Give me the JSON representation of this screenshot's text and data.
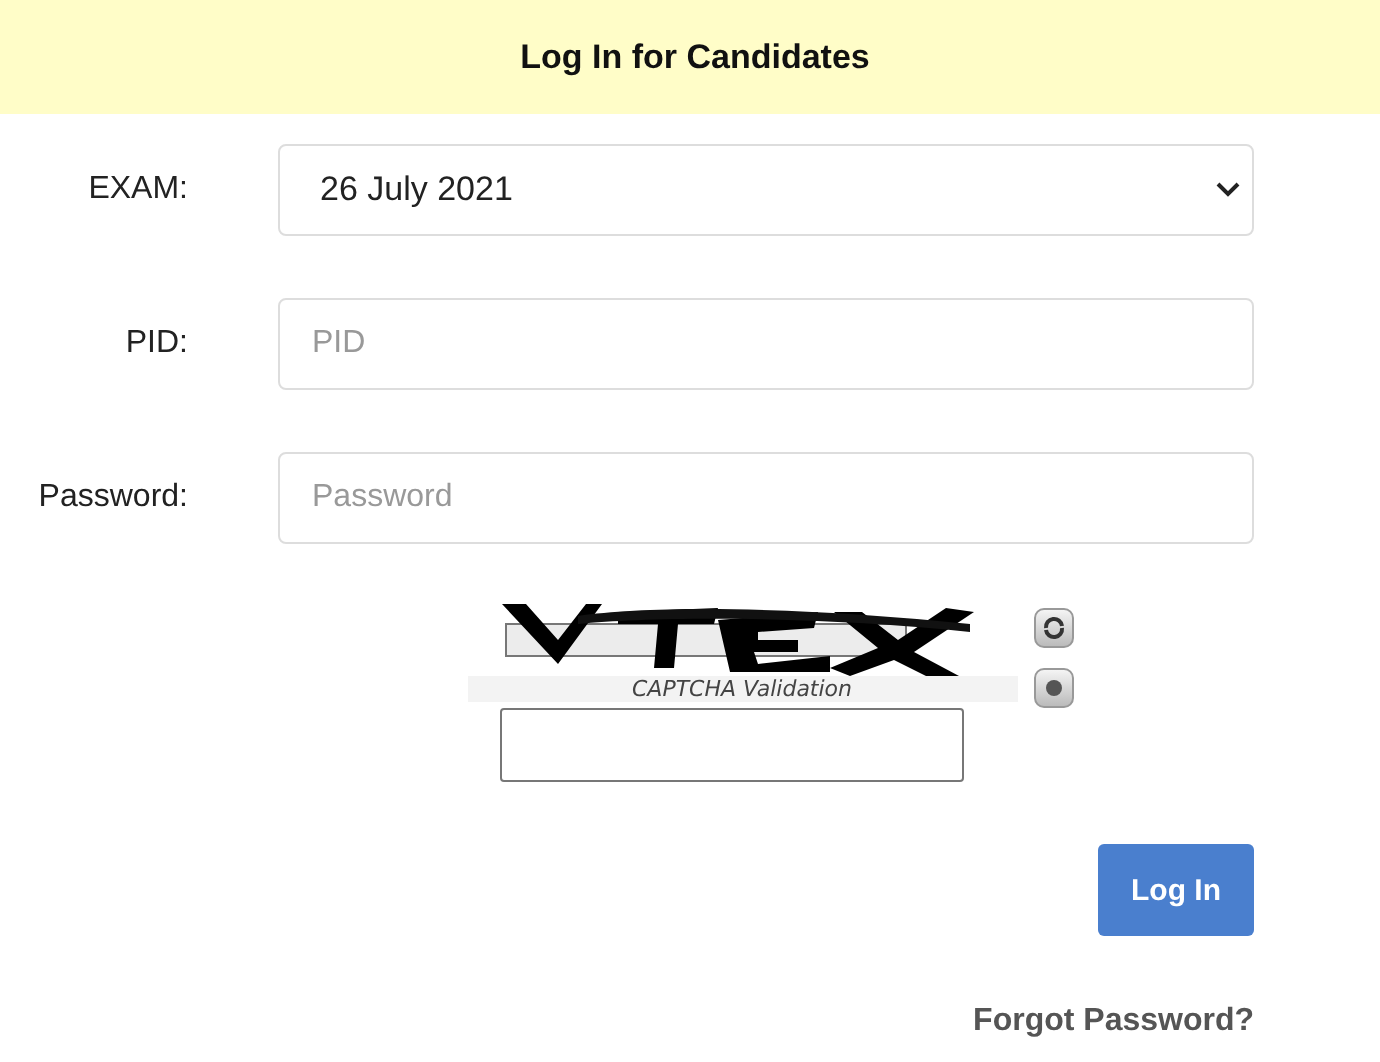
{
  "header": {
    "title": "Log In for Candidates"
  },
  "fields": [
    {
      "kind": "select",
      "label": "EXAM:",
      "value": "26 July 2021"
    },
    {
      "kind": "text",
      "label": "PID:",
      "placeholder": "PID"
    },
    {
      "kind": "password",
      "label": "Password:",
      "placeholder": "Password"
    }
  ],
  "captcha": {
    "caption": "CAPTCHA Validation"
  },
  "login_button": "Log In",
  "forgot_link": "Forgot Password?"
}
